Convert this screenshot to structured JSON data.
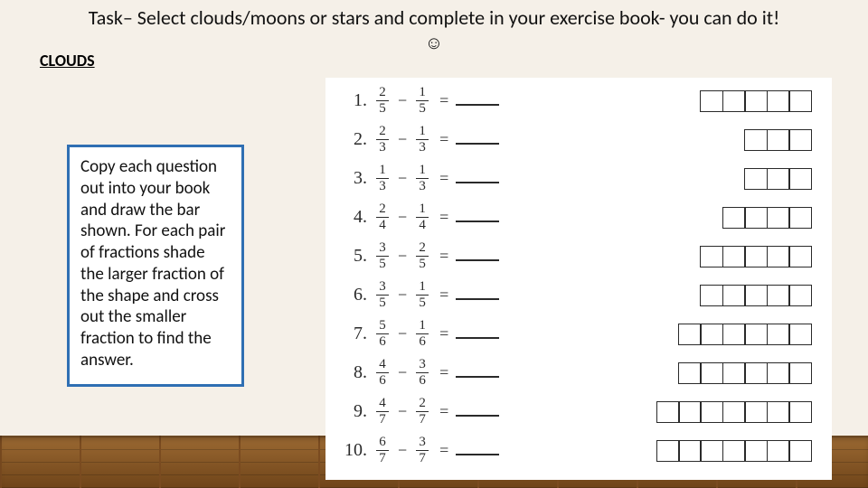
{
  "title_line": "Task– Select clouds/moons or stars and complete in your exercise book- you can do it!",
  "smiley": "☺",
  "section_label": "CLOUDS",
  "instruction": "Copy each question out into your book and draw the bar shown. For each pair of fractions shade the larger fraction of the shape and cross out the smaller fraction to find the answer.",
  "problems": [
    {
      "n": "1.",
      "a_num": "2",
      "a_den": "5",
      "b_num": "1",
      "b_den": "5",
      "boxes": 5
    },
    {
      "n": "2.",
      "a_num": "2",
      "a_den": "3",
      "b_num": "1",
      "b_den": "3",
      "boxes": 3
    },
    {
      "n": "3.",
      "a_num": "1",
      "a_den": "3",
      "b_num": "1",
      "b_den": "3",
      "boxes": 3
    },
    {
      "n": "4.",
      "a_num": "2",
      "a_den": "4",
      "b_num": "1",
      "b_den": "4",
      "boxes": 4
    },
    {
      "n": "5.",
      "a_num": "3",
      "a_den": "5",
      "b_num": "2",
      "b_den": "5",
      "boxes": 5
    },
    {
      "n": "6.",
      "a_num": "3",
      "a_den": "5",
      "b_num": "1",
      "b_den": "5",
      "boxes": 5
    },
    {
      "n": "7.",
      "a_num": "5",
      "a_den": "6",
      "b_num": "1",
      "b_den": "6",
      "boxes": 6
    },
    {
      "n": "8.",
      "a_num": "4",
      "a_den": "6",
      "b_num": "3",
      "b_den": "6",
      "boxes": 6
    },
    {
      "n": "9.",
      "a_num": "4",
      "a_den": "7",
      "b_num": "2",
      "b_den": "7",
      "boxes": 7
    },
    {
      "n": "10.",
      "a_num": "6",
      "a_den": "7",
      "b_num": "3",
      "b_den": "7",
      "boxes": 7
    }
  ],
  "op": "−",
  "equals": "="
}
